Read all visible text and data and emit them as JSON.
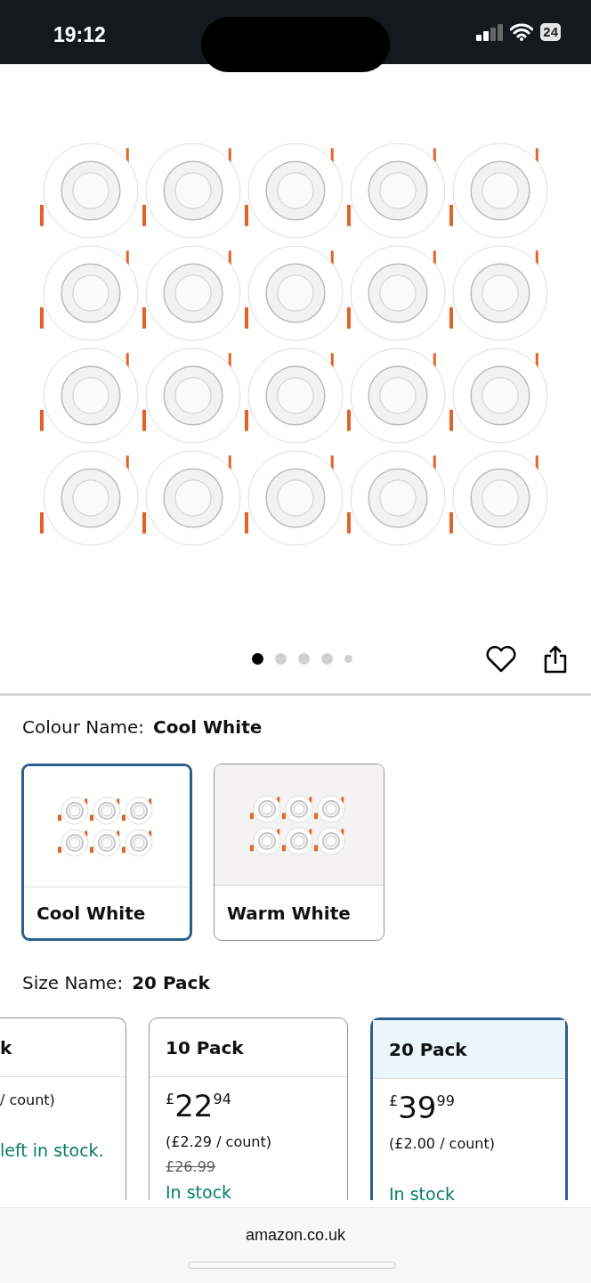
{
  "status_bar": {
    "time": "19:12",
    "battery": "24"
  },
  "gallery": {
    "dots": [
      {
        "selected": true
      },
      {
        "selected": false
      },
      {
        "selected": false
      },
      {
        "selected": false
      },
      {
        "selected": false
      }
    ]
  },
  "colour": {
    "label": "Colour Name:",
    "value": "Cool White",
    "options": [
      {
        "label": "Cool White",
        "selected": true
      },
      {
        "label": "Warm White",
        "selected": false
      }
    ]
  },
  "size": {
    "label": "Size Name:",
    "value": "20 Pack",
    "options": [
      {
        "label": "k",
        "unit_price": "/ count)",
        "stock": "left in stock.",
        "selected": false
      },
      {
        "label": "10 Pack",
        "currency": "£",
        "price_whole": "22",
        "price_fraction": "94",
        "unit_price": "(£2.29 / count)",
        "list_price": "£26.99",
        "stock": "In stock",
        "selected": false
      },
      {
        "label": "20 Pack",
        "currency": "£",
        "price_whole": "39",
        "price_fraction": "99",
        "unit_price": "(£2.00 / count)",
        "stock": "In stock",
        "selected": true
      }
    ]
  },
  "browser": {
    "url": "amazon.co.uk"
  }
}
